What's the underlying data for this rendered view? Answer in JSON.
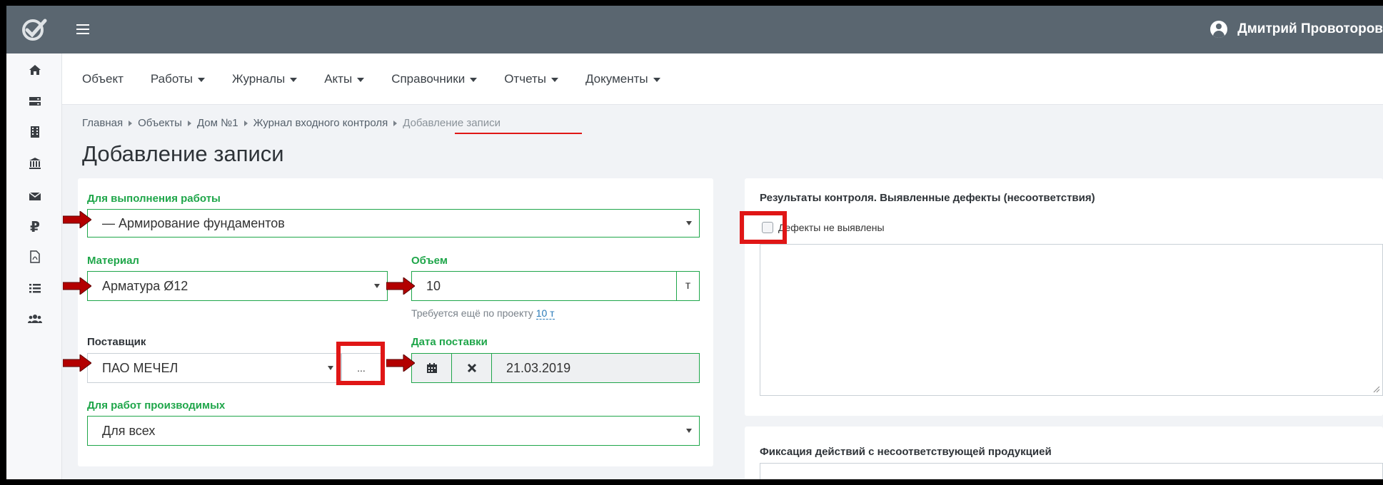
{
  "header": {
    "user_name": "Дмитрий Провоторов",
    "brand_color": "#5a6670"
  },
  "sidebar": {
    "items": [
      {
        "icon": "home-icon"
      },
      {
        "icon": "server-icon"
      },
      {
        "icon": "building-icon"
      },
      {
        "icon": "bank-icon"
      },
      {
        "icon": "envelope-icon"
      },
      {
        "icon": "ruble-icon"
      },
      {
        "icon": "pdf-file-icon"
      },
      {
        "icon": "list-icon"
      },
      {
        "icon": "users-icon"
      }
    ]
  },
  "nav": {
    "items": [
      {
        "label": "Объект",
        "dropdown": false
      },
      {
        "label": "Работы",
        "dropdown": true
      },
      {
        "label": "Журналы",
        "dropdown": true
      },
      {
        "label": "Акты",
        "dropdown": true
      },
      {
        "label": "Справочники",
        "dropdown": true
      },
      {
        "label": "Отчеты",
        "dropdown": true
      },
      {
        "label": "Документы",
        "dropdown": true
      }
    ]
  },
  "breadcrumb": {
    "items": [
      "Главная",
      "Объекты",
      "Дом №1",
      "Журнал входного контроля"
    ],
    "active": "Добавление записи"
  },
  "page": {
    "title": "Добавление записи"
  },
  "form": {
    "work": {
      "label": "Для выполнения работы",
      "value": "— Армирование фундаментов"
    },
    "material": {
      "label": "Материал",
      "value": "Арматура Ø12"
    },
    "volume": {
      "label": "Объем",
      "value": "10",
      "unit": "т",
      "hint": "Требуется ещё по проекту",
      "hint_link": "10 т"
    },
    "supplier": {
      "label": "Поставщик",
      "value": "ПАО МЕЧЕЛ",
      "more_button": "..."
    },
    "delivery_date": {
      "label": "Дата поставки",
      "value": "21.03.2019"
    },
    "for_works": {
      "label": "Для работ производимых",
      "value": "Для всех"
    }
  },
  "results": {
    "title": "Результаты контроля. Выявленные дефекты (несоответствия)",
    "checkbox_label": "Дефекты не выявлены",
    "checked": false
  },
  "actions": {
    "title": "Фиксация действий с несоответствующей продукцией"
  },
  "colors": {
    "accent_green": "#1fa64a",
    "highlight_red": "#e01616",
    "arrow_red": "#b30000"
  }
}
